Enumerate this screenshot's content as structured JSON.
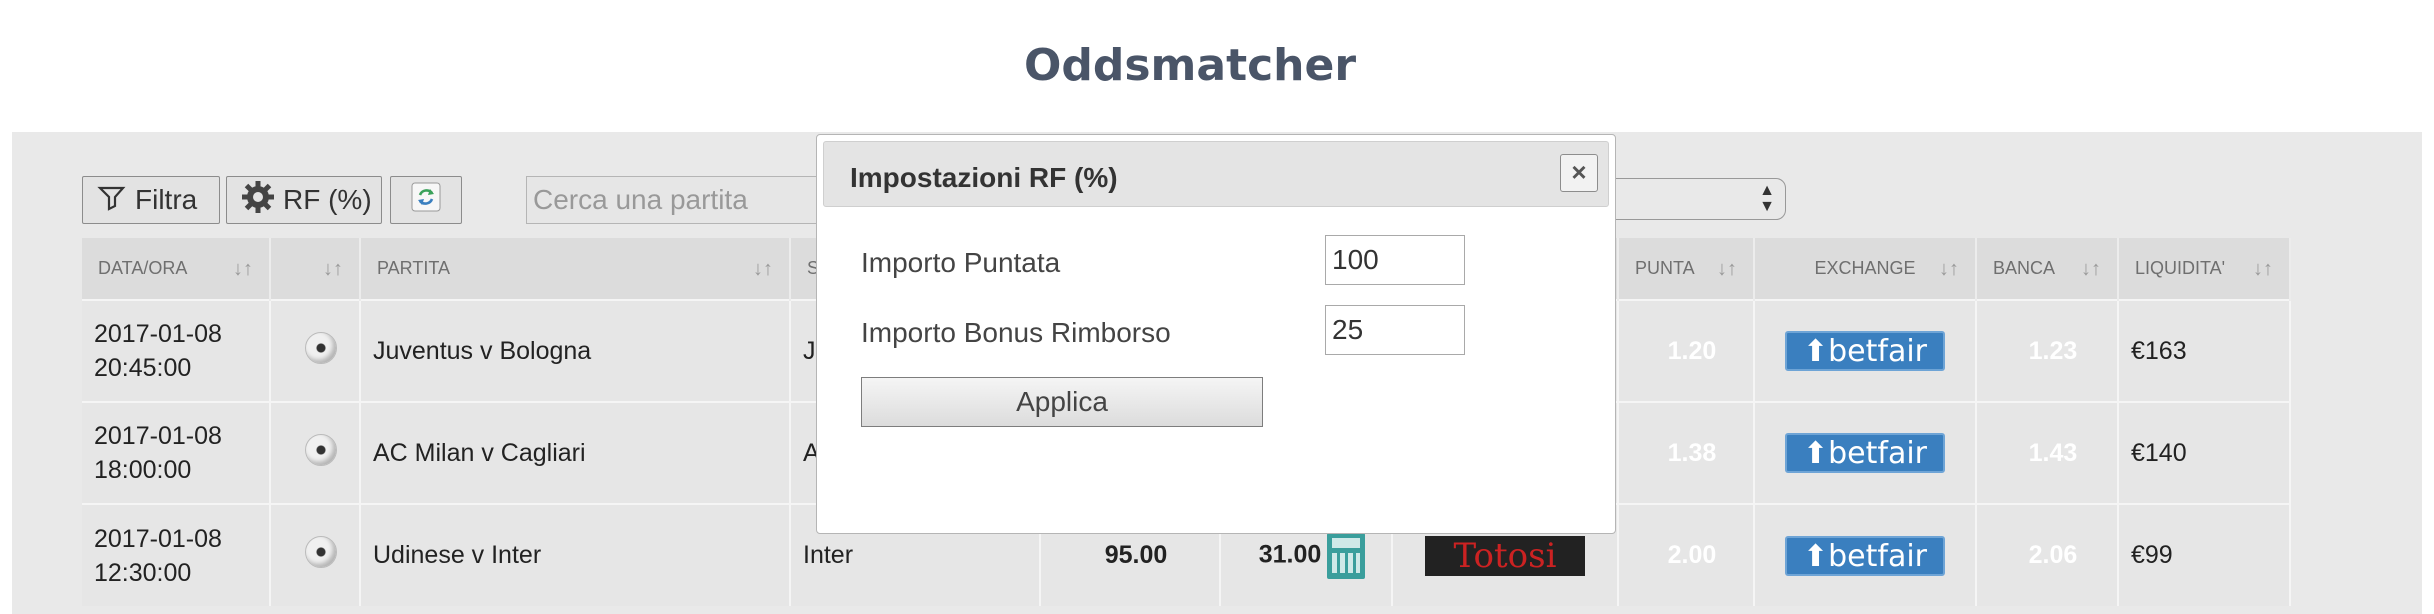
{
  "page_title": "Oddsmatcher",
  "toolbar": {
    "filter_label": "Filtra",
    "rf_label": "RF (%)",
    "search_placeholder": "Cerca una partita"
  },
  "table": {
    "headers": [
      "DATA/ORA",
      "",
      "PARTITA",
      "S",
      "PUNTA",
      "EXCHANGE",
      "BANCA",
      "LIQUIDITA'"
    ],
    "rows": [
      {
        "date": "2017-01-08",
        "time": "20:45:00",
        "match": "Juventus v Bologna",
        "selection": "J",
        "punta": "1.20",
        "exchange": "betfair",
        "banca": "1.23",
        "liquidity": "€163"
      },
      {
        "date": "2017-01-08",
        "time": "18:00:00",
        "match": "AC Milan v Cagliari",
        "selection": "A",
        "punta": "1.38",
        "exchange": "betfair",
        "banca": "1.43",
        "liquidity": "€140"
      },
      {
        "date": "2017-01-08",
        "time": "12:30:00",
        "match": "Udinese v Inter",
        "selection": "Inter",
        "rating": "95.00",
        "rf": "31.00",
        "bookmaker": "Totosi",
        "punta": "2.00",
        "exchange": "betfair",
        "banca": "2.06",
        "liquidity": "€99"
      }
    ]
  },
  "modal": {
    "title": "Impostazioni RF (%)",
    "close_symbol": "×",
    "stake_label": "Importo Puntata",
    "stake_value": "100",
    "bonus_label": "Importo Bonus Rimborso",
    "bonus_value": "25",
    "apply_label": "Applica"
  },
  "colors": {
    "punta": "#33aeb0",
    "banca": "#df6b66",
    "betfair": "#3a7fbf"
  }
}
